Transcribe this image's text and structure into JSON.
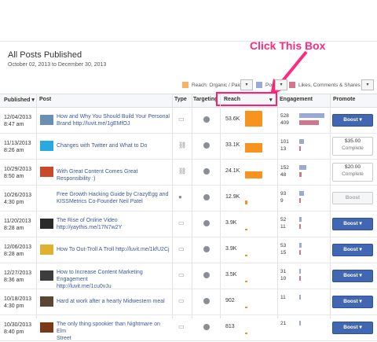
{
  "page": {
    "title": "All Posts Published",
    "date_range": "October 02, 2013 to December 30, 2013"
  },
  "callout": {
    "text": "Click This Box"
  },
  "legend": {
    "reach_label": "Reach: Organic / Paid",
    "posts_label": "Pos",
    "engagement_label": "Likes, Comments & Shares",
    "colors": {
      "reach": "#f7b267",
      "posts": "#9ba9d5",
      "engagement": "#d2758d"
    }
  },
  "table": {
    "headers": {
      "published": "Published",
      "post": "Post",
      "type": "Type",
      "targeting": "Targeting",
      "reach": "Reach",
      "engagement": "Engagement",
      "promote": "Promote"
    },
    "rows": [
      {
        "date": "12/04/2013",
        "time": "8:47 am",
        "post_l1": "How and Why You Should Build Your Personal",
        "post_l2": "Brand http://luvit.me/1gEMfOJ",
        "type_icon": "status-icon",
        "reach": "53.6K",
        "reach_value": 53.6,
        "eng_top": "528",
        "eng_bottom": "409",
        "eng_top_value": 528,
        "eng_bottom_value": 409,
        "promote": {
          "kind": "boost",
          "label": "Boost ▾"
        },
        "thumb_color": "#6a8fb5"
      },
      {
        "date": "11/13/2013",
        "time": "8:26 am",
        "post_l1": "Changes with Twitter and What to Do",
        "post_l2": "",
        "type_icon": "link-icon",
        "reach": "33.1K",
        "reach_value": 33.1,
        "eng_top": "101",
        "eng_bottom": "13",
        "eng_top_value": 101,
        "eng_bottom_value": 13,
        "promote": {
          "kind": "paid",
          "amount": "$35.00",
          "status": "Complete"
        },
        "thumb_color": "#2aa9e0"
      },
      {
        "date": "10/29/2013",
        "time": "8:50 am",
        "post_l1": "With Great Content Comes Great Responsibility :)",
        "post_l2": "",
        "type_icon": "link-icon",
        "reach": "24.1K",
        "reach_value": 24.1,
        "eng_top": "152",
        "eng_bottom": "48",
        "eng_top_value": 152,
        "eng_bottom_value": 48,
        "promote": {
          "kind": "paid",
          "amount": "$20.00",
          "status": "Complete"
        },
        "thumb_color": "#c94a2a"
      },
      {
        "date": "10/26/2013",
        "time": "4:30 pm",
        "post_l1": "Free Growth Hacking Guide by CrazyEgg and",
        "post_l2": "KISSMetrics Co-Founder Neil Patel",
        "type_icon": "status-dot-icon",
        "reach": "12.9K",
        "reach_value": 12.9,
        "eng_top": "93",
        "eng_bottom": "9",
        "eng_top_value": 93,
        "eng_bottom_value": 9,
        "promote": {
          "kind": "disabled",
          "label": "Boost"
        },
        "thumb_color": ""
      },
      {
        "date": "11/20/2013",
        "time": "8:28 am",
        "post_l1": "The Rise of Online Video",
        "post_l2": "http://yaythis.me/17N7w2Y",
        "type_icon": "photo-icon",
        "reach": "3.9K",
        "reach_value": 3.9,
        "eng_top": "52",
        "eng_bottom": "11",
        "eng_top_value": 52,
        "eng_bottom_value": 11,
        "promote": {
          "kind": "boost",
          "label": "Boost ▾"
        },
        "thumb_color": "#2b2b2b"
      },
      {
        "date": "12/06/2013",
        "time": "8:28 am",
        "post_l1": "How To Out-Troll A Troll http://luvit.me/1kfU2Cj",
        "post_l2": "",
        "type_icon": "photo-icon",
        "reach": "3.9K",
        "reach_value": 3.9,
        "eng_top": "53",
        "eng_bottom": "15",
        "eng_top_value": 53,
        "eng_bottom_value": 15,
        "promote": {
          "kind": "boost",
          "label": "Boost ▾"
        },
        "thumb_color": "#e0b030"
      },
      {
        "date": "12/27/2013",
        "time": "8:36 am",
        "post_l1": "How to Increase Content Marketing Engagement",
        "post_l2": "http://luvit.me/1cu0vJu",
        "type_icon": "photo-icon",
        "reach": "3.5K",
        "reach_value": 3.5,
        "eng_top": "31",
        "eng_bottom": "10",
        "eng_top_value": 31,
        "eng_bottom_value": 10,
        "promote": {
          "kind": "boost",
          "label": "Boost ▾"
        },
        "thumb_color": "#3d3d3d"
      },
      {
        "date": "10/18/2013",
        "time": "4:30 pm",
        "post_l1": "Hard at work after a hearty Midwestern meal",
        "post_l2": "",
        "type_icon": "photo-icon",
        "reach": "902",
        "reach_value": 0.9,
        "eng_top": "11",
        "eng_bottom": "",
        "eng_top_value": 11,
        "eng_bottom_value": 0,
        "promote": {
          "kind": "boost",
          "label": "Boost ▾"
        },
        "thumb_color": "#5a4632"
      },
      {
        "date": "10/30/2013",
        "time": "8:40 pm",
        "post_l1": "The only thing spookier than Nightmare on Elm",
        "post_l2": "Street",
        "type_icon": "photo-icon",
        "reach": "813",
        "reach_value": 0.8,
        "eng_top": "21",
        "eng_bottom": "",
        "eng_top_value": 21,
        "eng_bottom_value": 0,
        "promote": {
          "kind": "boost",
          "label": "Boost ▾"
        },
        "thumb_color": "#7a3a1a"
      }
    ]
  }
}
